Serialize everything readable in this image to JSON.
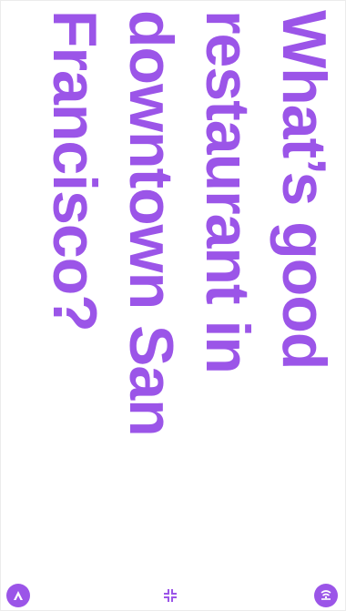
{
  "query": {
    "lines": [
      "What’s good",
      "restaurant in",
      "downtown San",
      "Francisco?"
    ]
  },
  "colors": {
    "accent": "#9b55e8",
    "background": "#ffffff"
  },
  "controls": {
    "left_icon": "assistant-logo-icon",
    "center_icon": "collapse-arrows-icon",
    "right_icon": "voice-waves-icon"
  }
}
